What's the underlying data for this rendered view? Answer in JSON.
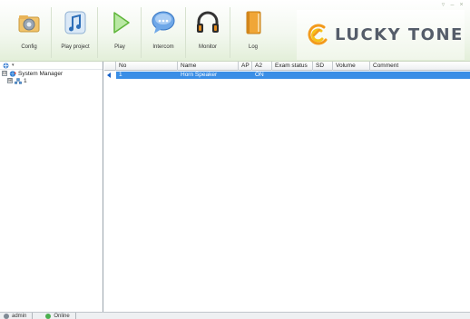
{
  "window": {
    "controls": [
      "pin-icon",
      "minimize-icon",
      "close-icon"
    ],
    "control_glyphs": [
      "▿",
      "–",
      "×"
    ]
  },
  "toolbar": {
    "buttons": [
      {
        "label": "Config",
        "icon": "gear-folder-icon"
      },
      {
        "label": "Play project",
        "icon": "music-note-icon"
      },
      {
        "label": "Play",
        "icon": "play-triangle-icon"
      },
      {
        "label": "Intercom",
        "icon": "speech-bubble-icon"
      },
      {
        "label": "Monitor",
        "icon": "headphones-icon"
      },
      {
        "label": "Log",
        "icon": "book-icon"
      }
    ]
  },
  "logo": {
    "brand": "LUCKY TONE",
    "colors": {
      "mark_orange": "#f39a1c",
      "mark_yellow": "#f6c21a",
      "text": "#555d6a"
    }
  },
  "tree": {
    "header_glyph": "▾",
    "root": {
      "expander": "⊟",
      "label": "System Manager",
      "icon": "globe-network-icon"
    },
    "children": [
      {
        "expander": "⊞",
        "label": "1",
        "icon": "network-node-icon"
      }
    ]
  },
  "grid": {
    "columns": [
      "No",
      "Name",
      "AP",
      "A2",
      "Exam status",
      "SD",
      "Volume",
      "Comment"
    ],
    "rows": [
      {
        "no": "1",
        "name": "Horn Speaker",
        "ap": "",
        "a2": "ON",
        "exam_status": "",
        "sd": "",
        "volume": "",
        "comment": "",
        "selected": true
      }
    ],
    "colors": {
      "selected_bg": "#3a8ee6",
      "selected_fg": "#ffffff"
    }
  },
  "statusbar": {
    "user": "admin",
    "state": "Online"
  }
}
